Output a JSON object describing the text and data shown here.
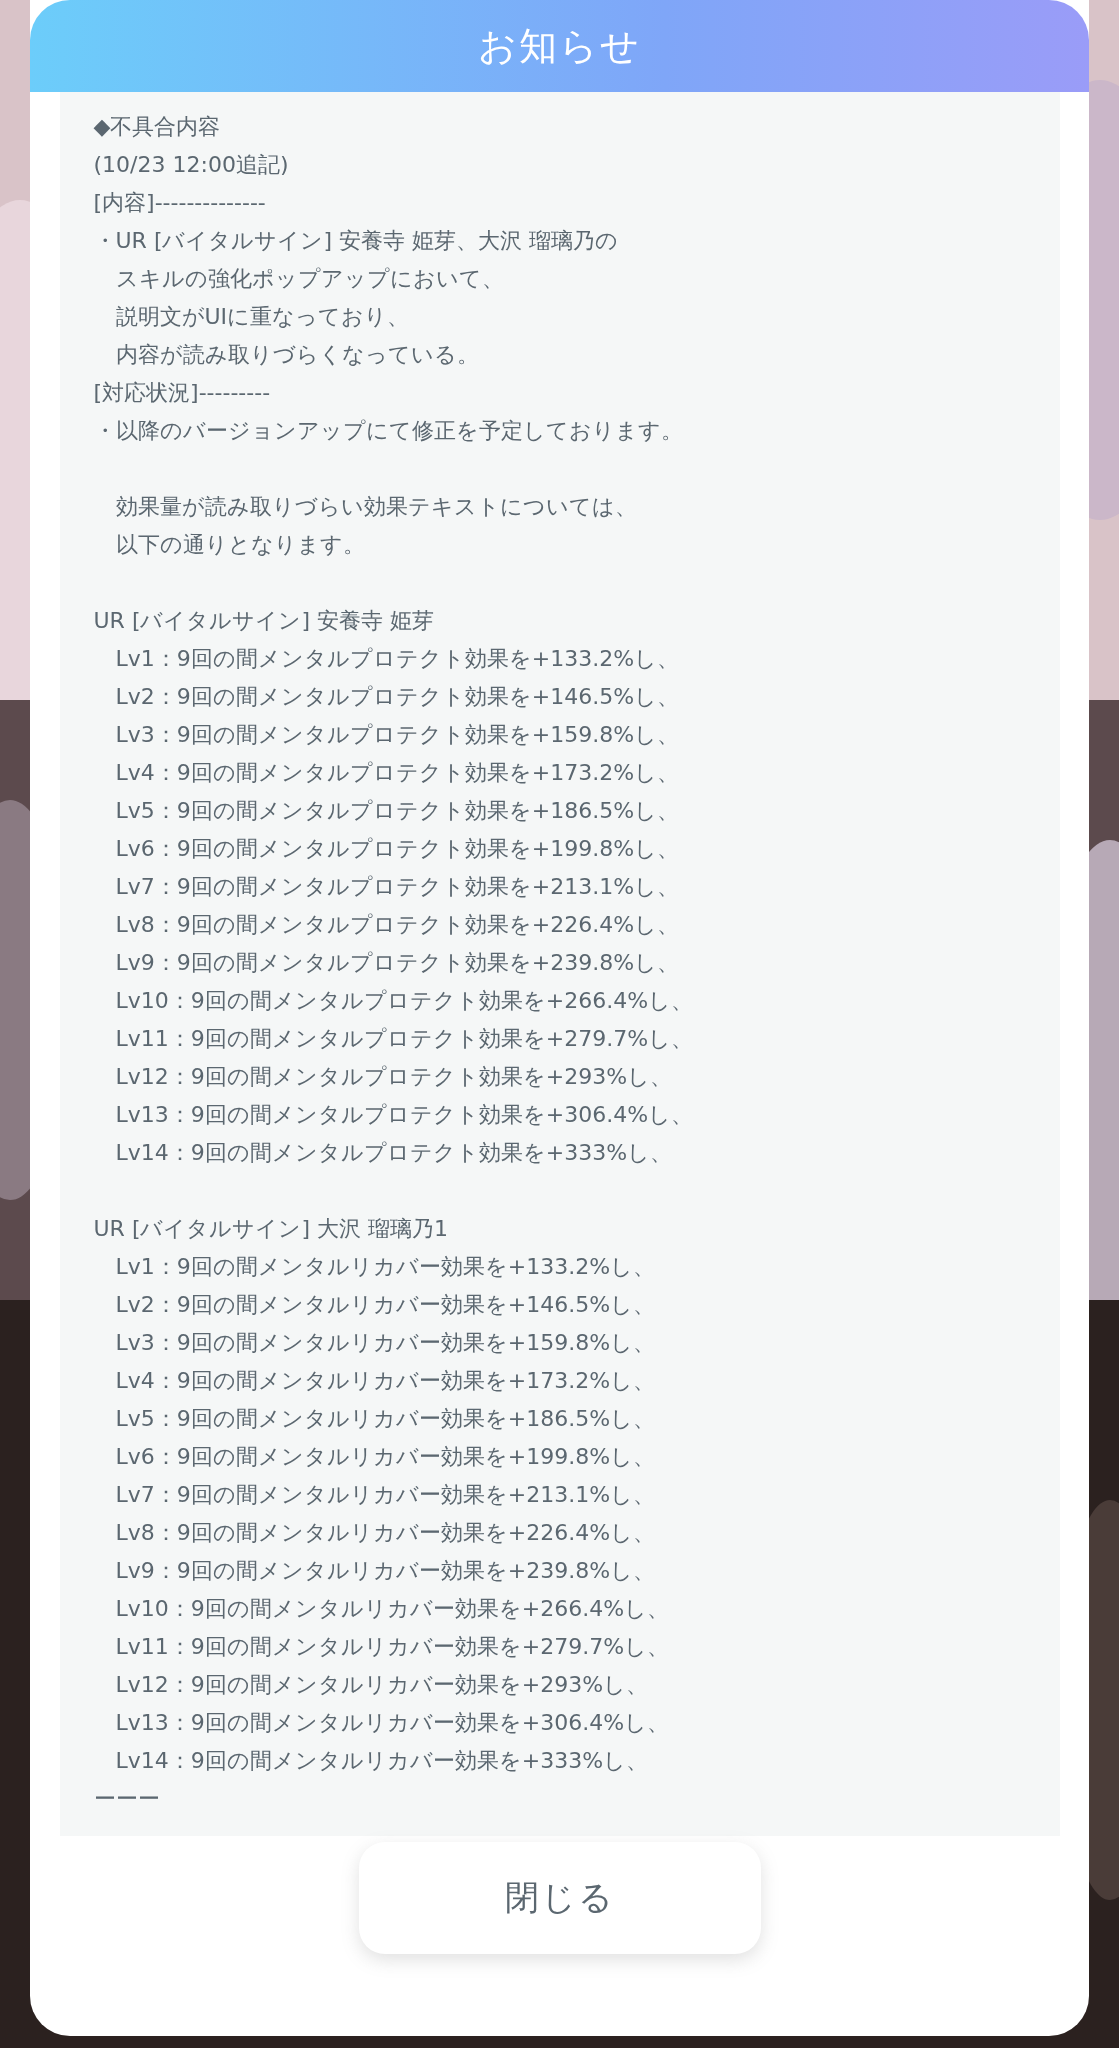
{
  "dialog": {
    "title": "お知らせ",
    "close_button": "閉じる"
  },
  "blocks": [
    {
      "lines": [
        {
          "text": "◆不具合内容",
          "indent": false
        },
        {
          "text": "(10/23 12:00追記)",
          "indent": false
        },
        {
          "text": "[内容]--------------",
          "indent": false
        },
        {
          "text": "・UR [バイタルサイン] 安養寺 姫芽、大沢 瑠璃乃の",
          "indent": false
        },
        {
          "text": "スキルの強化ポップアップにおいて、",
          "indent": true
        },
        {
          "text": "説明文がUIに重なっており、",
          "indent": true
        },
        {
          "text": "内容が読み取りづらくなっている。",
          "indent": true
        },
        {
          "text": "[対応状況]---------",
          "indent": false
        },
        {
          "text": "・以降のバージョンアップにて修正を予定しております。",
          "indent": false
        }
      ]
    },
    {
      "lines": [
        {
          "text": "効果量が読み取りづらい効果テキストについては、",
          "indent": true
        },
        {
          "text": "以下の通りとなります。",
          "indent": true
        }
      ]
    },
    {
      "lines": [
        {
          "text": "UR [バイタルサイン] 安養寺 姫芽",
          "indent": false
        },
        {
          "text": "Lv1：9回の間メンタルプロテクト効果を+133.2%し、",
          "indent": true
        },
        {
          "text": "Lv2：9回の間メンタルプロテクト効果を+146.5%し、",
          "indent": true
        },
        {
          "text": "Lv3：9回の間メンタルプロテクト効果を+159.8%し、",
          "indent": true
        },
        {
          "text": "Lv4：9回の間メンタルプロテクト効果を+173.2%し、",
          "indent": true
        },
        {
          "text": "Lv5：9回の間メンタルプロテクト効果を+186.5%し、",
          "indent": true
        },
        {
          "text": "Lv6：9回の間メンタルプロテクト効果を+199.8%し、",
          "indent": true
        },
        {
          "text": "Lv7：9回の間メンタルプロテクト効果を+213.1%し、",
          "indent": true
        },
        {
          "text": "Lv8：9回の間メンタルプロテクト効果を+226.4%し、",
          "indent": true
        },
        {
          "text": "Lv9：9回の間メンタルプロテクト効果を+239.8%し、",
          "indent": true
        },
        {
          "text": "Lv10：9回の間メンタルプロテクト効果を+266.4%し、",
          "indent": true
        },
        {
          "text": "Lv11：9回の間メンタルプロテクト効果を+279.7%し、",
          "indent": true
        },
        {
          "text": "Lv12：9回の間メンタルプロテクト効果を+293%し、",
          "indent": true
        },
        {
          "text": "Lv13：9回の間メンタルプロテクト効果を+306.4%し、",
          "indent": true
        },
        {
          "text": "Lv14：9回の間メンタルプロテクト効果を+333%し、",
          "indent": true
        }
      ]
    },
    {
      "lines": [
        {
          "text": "UR [バイタルサイン] 大沢 瑠璃乃1",
          "indent": false
        },
        {
          "text": "Lv1：9回の間メンタルリカバー効果を+133.2%し、",
          "indent": true
        },
        {
          "text": "Lv2：9回の間メンタルリカバー効果を+146.5%し、",
          "indent": true
        },
        {
          "text": "Lv3：9回の間メンタルリカバー効果を+159.8%し、",
          "indent": true
        },
        {
          "text": "Lv4：9回の間メンタルリカバー効果を+173.2%し、",
          "indent": true
        },
        {
          "text": "Lv5：9回の間メンタルリカバー効果を+186.5%し、",
          "indent": true
        },
        {
          "text": "Lv6：9回の間メンタルリカバー効果を+199.8%し、",
          "indent": true
        },
        {
          "text": "Lv7：9回の間メンタルリカバー効果を+213.1%し、",
          "indent": true
        },
        {
          "text": "Lv8：9回の間メンタルリカバー効果を+226.4%し、",
          "indent": true
        },
        {
          "text": "Lv9：9回の間メンタルリカバー効果を+239.8%し、",
          "indent": true
        },
        {
          "text": "Lv10：9回の間メンタルリカバー効果を+266.4%し、",
          "indent": true
        },
        {
          "text": "Lv11：9回の間メンタルリカバー効果を+279.7%し、",
          "indent": true
        },
        {
          "text": "Lv12：9回の間メンタルリカバー効果を+293%し、",
          "indent": true
        },
        {
          "text": "Lv13：9回の間メンタルリカバー効果を+306.4%し、",
          "indent": true
        },
        {
          "text": "Lv14：9回の間メンタルリカバー効果を+333%し、",
          "indent": true
        },
        {
          "text": "ーーー",
          "indent": false
        }
      ]
    }
  ]
}
